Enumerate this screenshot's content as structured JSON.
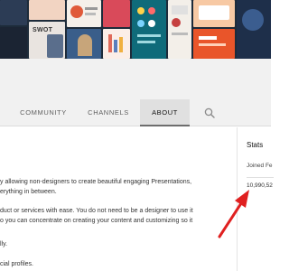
{
  "banner": {
    "tile_label": "SWOT"
  },
  "tabs": [
    {
      "label": "COMMUNITY",
      "active": false
    },
    {
      "label": "CHANNELS",
      "active": false
    },
    {
      "label": "ABOUT",
      "active": true
    }
  ],
  "search_icon": "search-icon",
  "about": {
    "lines": [
      "y allowing non-designers to create beautiful engaging Presentations,",
      "erything in between.",
      "duct or services with ease.  You do not need to be a designer to use it",
      "o you can concentrate on creating your content and customizing so it",
      "lly.",
      "cial profiles."
    ]
  },
  "stats": {
    "title": "Stats",
    "joined": "Joined Fe",
    "views": "10,990,52"
  },
  "colors": {
    "arrow": "#e02020",
    "active_tab_bg": "#e0e0e0"
  }
}
